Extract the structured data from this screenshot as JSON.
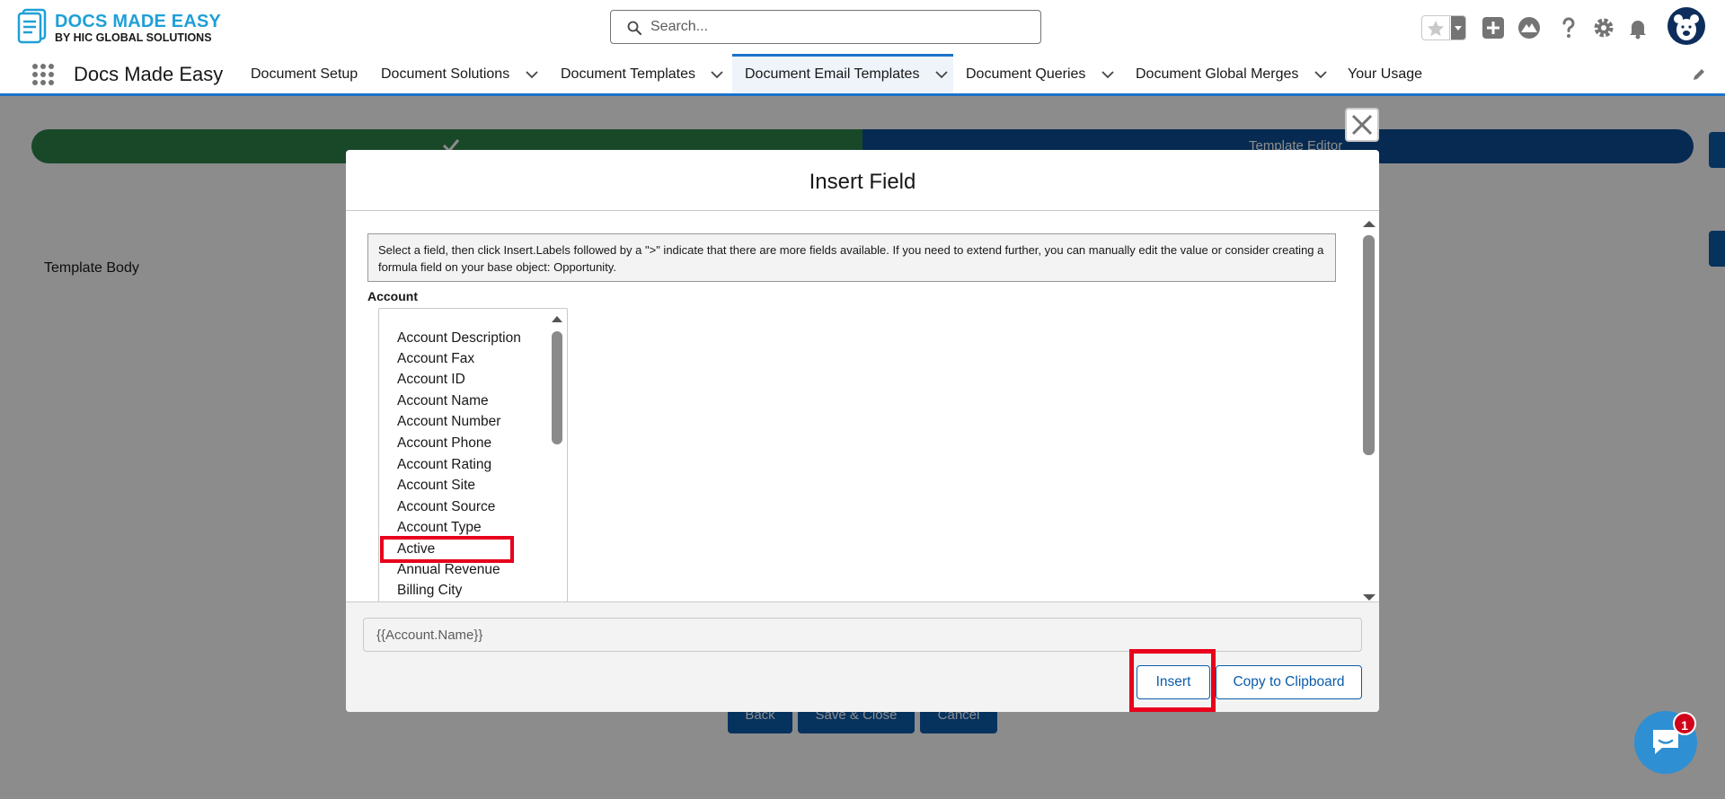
{
  "brand": {
    "logo_line1": "DOCS MADE EASY",
    "logo_line2": "BY HIC GLOBAL SOLUTIONS",
    "accent_color": "#1f9fd7",
    "primary_blue": "#0b5cab"
  },
  "search": {
    "placeholder": "Search..."
  },
  "header_icons": [
    "favorite-star-icon",
    "add-icon",
    "trailhead-icon",
    "help-icon",
    "setup-gear-icon",
    "notification-bell-icon",
    "user-avatar"
  ],
  "nav": {
    "app_name": "Docs Made Easy",
    "tabs": [
      {
        "label": "Document Setup",
        "has_menu": false
      },
      {
        "label": "Document Solutions",
        "has_menu": true
      },
      {
        "label": "Document Templates",
        "has_menu": true
      },
      {
        "label": "Document Email Templates",
        "has_menu": true,
        "active": true
      },
      {
        "label": "Document Queries",
        "has_menu": true
      },
      {
        "label": "Document Global Merges",
        "has_menu": true
      },
      {
        "label": "Your Usage",
        "has_menu": false
      }
    ]
  },
  "background_page": {
    "path_step_2": "Template Editor",
    "template_body_label": "Template Body",
    "buttons": {
      "back": "Back",
      "save_close": "Save & Close",
      "cancel": "Cancel"
    }
  },
  "modal": {
    "title": "Insert Field",
    "help_text": "Select a field, then click Insert.Labels followed by a \">\" indicate that there are more fields available. If you need to extend further, you can manually edit the value or consider creating a formula field on your base object: Opportunity.",
    "section_label": "Account",
    "fields": [
      "Account Description",
      "Account Fax",
      "Account ID",
      "Account Name",
      "Account Number",
      "Account Phone",
      "Account Rating",
      "Account Site",
      "Account Source",
      "Account Type",
      "Active",
      "Annual Revenue",
      "Billing City"
    ],
    "selected_field": "Account Name",
    "merge_value": "{{Account.Name}}",
    "insert_label": "Insert",
    "copy_label": "Copy to Clipboard",
    "highlight_color": "#e8001c"
  },
  "chat": {
    "badge_count": "1"
  }
}
